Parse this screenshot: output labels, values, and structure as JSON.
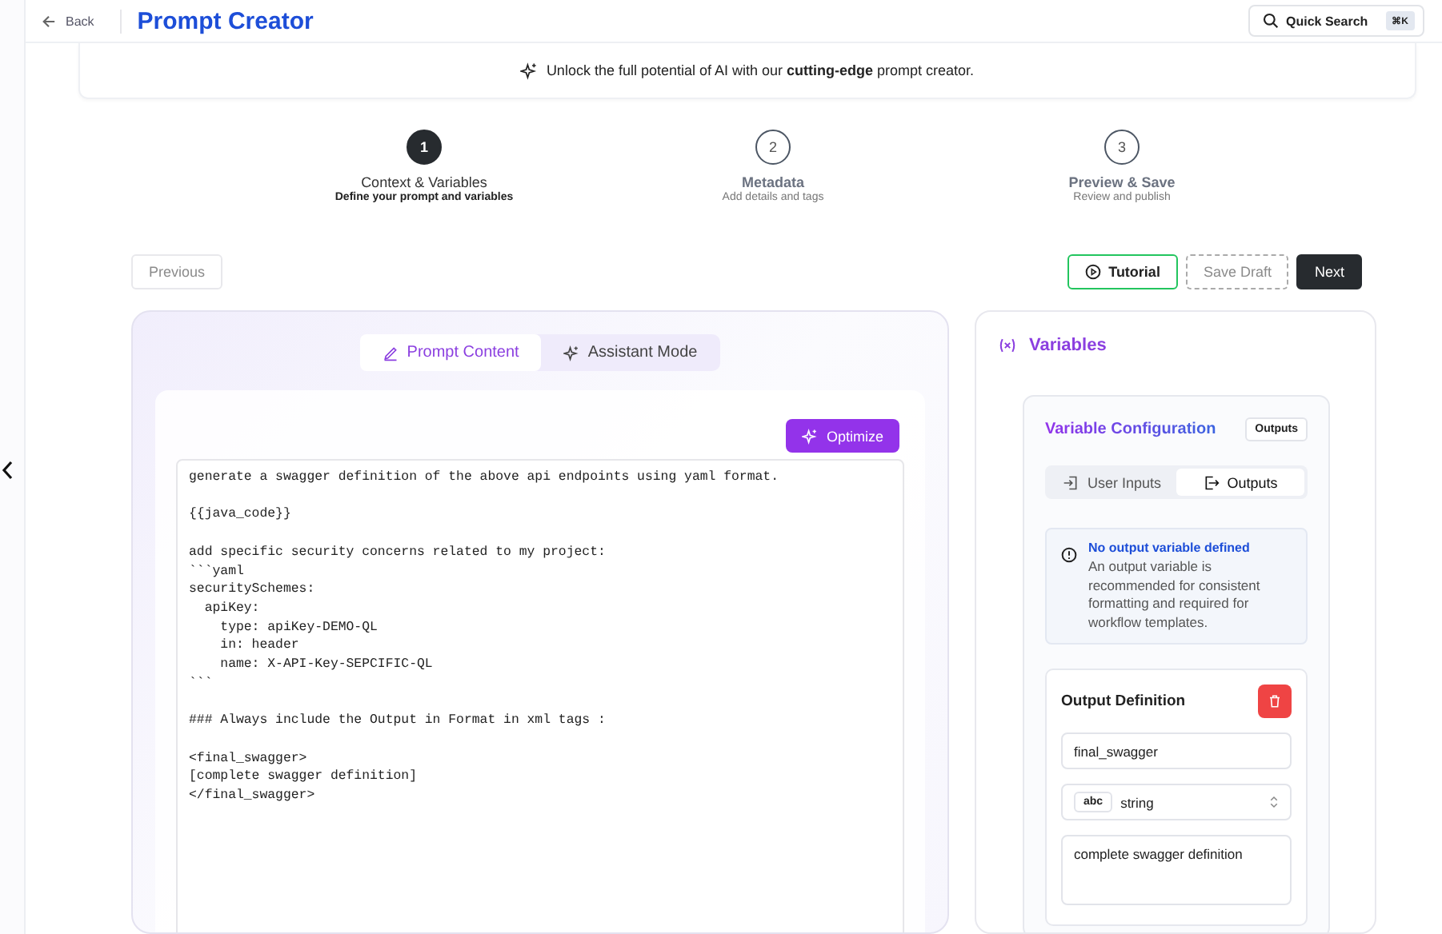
{
  "header": {
    "back_label": "Back",
    "title": "Prompt Creator",
    "search": {
      "label": "Quick Search",
      "shortcut": "⌘K"
    }
  },
  "banner": {
    "text": "Unlock the full potential of AI with our **cutting-edge** prompt creator."
  },
  "steps": [
    {
      "number": "1",
      "title": "Context & Variables",
      "subtitle": "Define your prompt and variables",
      "selected": true
    },
    {
      "number": "2",
      "title": "Metadata",
      "subtitle": "Add details and tags",
      "selected": false
    },
    {
      "number": "3",
      "title": "Preview & Save",
      "subtitle": "Review and publish",
      "selected": false
    }
  ],
  "nav": {
    "previous": {
      "label": "Previous",
      "disabled": true
    },
    "tutorial": "Tutorial",
    "save_draft": {
      "label": "Save Draft",
      "disabled": true
    },
    "next": "Next"
  },
  "editor": {
    "tabs": [
      {
        "label": "Prompt Content",
        "kind": "pencil",
        "selected": true
      },
      {
        "label": "Assistant Mode",
        "kind": "sparkles",
        "selected": false
      }
    ],
    "optimize_label": "Optimize",
    "prompt": "generate a swagger definition of the above api endpoints using yaml format.\n\n{{java_code}}\n\nadd specific security concerns related to my project:\n```yaml\nsecuritySchemes:\n  apiKey:\n    type: apiKey-DEMO-QL\n    in: header\n    name: X-API-Key-SEPCIFIC-QL\n```\n\n### Always include the Output in Format in xml tags :\n\n<final_swagger>\n[complete swagger definition]\n</final_swagger>"
  },
  "variables": {
    "title": "Variables",
    "config_title": "Variable Configuration",
    "config_badge": "Outputs",
    "segments": [
      {
        "label": "User Inputs",
        "kind": "input",
        "selected": false
      },
      {
        "label": "Outputs",
        "kind": "output",
        "selected": true
      }
    ],
    "notice": {
      "title": "No output variable defined",
      "text": "An output variable is recommended for consistent formatting and required for workflow templates."
    },
    "output": {
      "title": "Output Definition",
      "name": "final_swagger",
      "type_badge": "abc",
      "type": "string",
      "description": "complete swagger definition"
    }
  }
}
